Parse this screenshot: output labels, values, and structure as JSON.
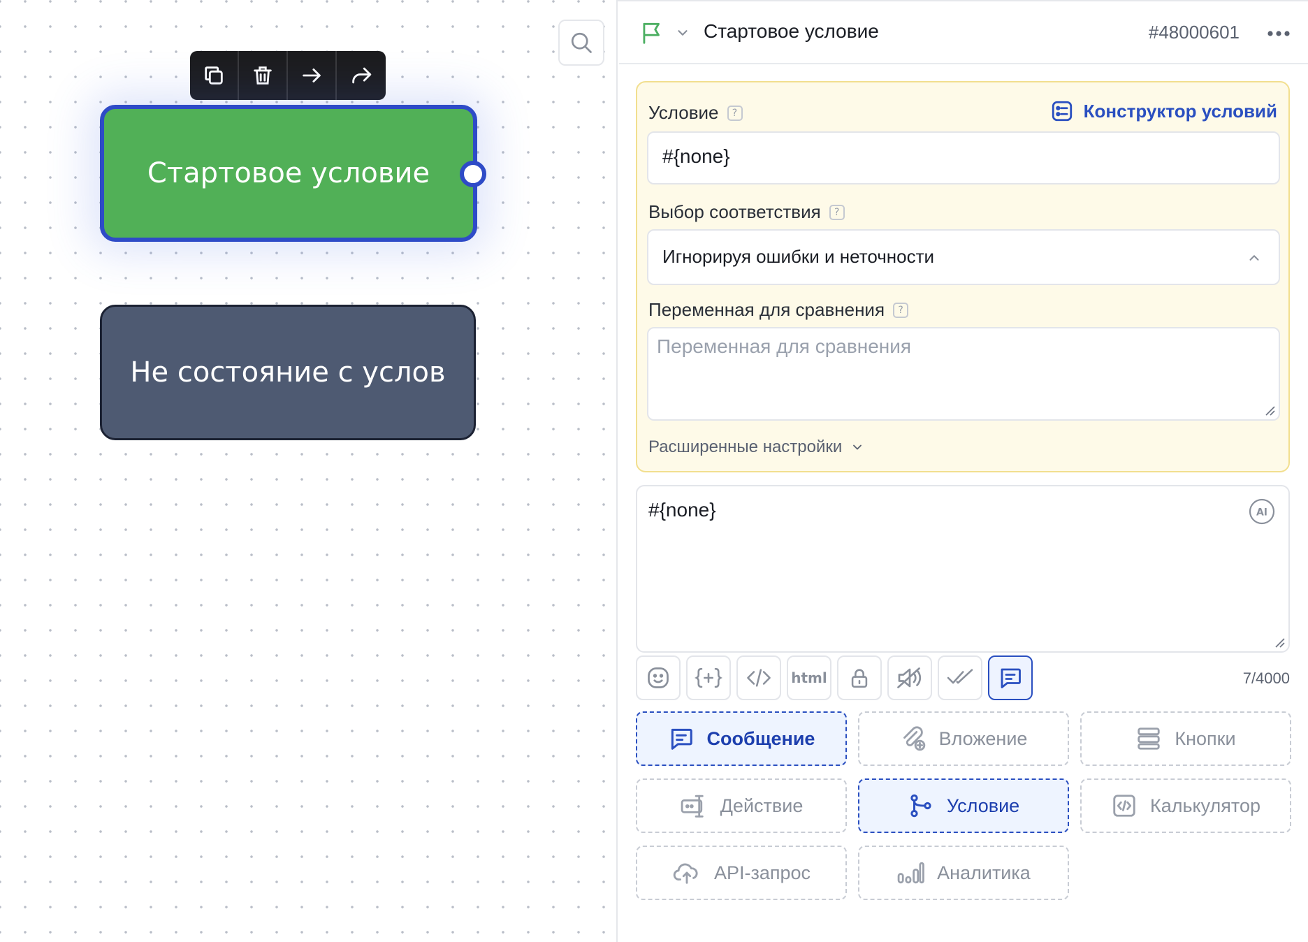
{
  "canvas": {
    "toolbar": {
      "buttons": [
        "copy-icon",
        "trash-icon",
        "arrow-right-icon",
        "share-icon"
      ]
    },
    "nodes": [
      {
        "label": "Стартовое условие",
        "color": "#51b057",
        "selected": true
      },
      {
        "label": "Не состояние с услов",
        "color": "#4e5a72",
        "selected": false
      }
    ]
  },
  "panel": {
    "header": {
      "title": "Стартовое условие",
      "id": "#48000601"
    },
    "condition": {
      "label": "Условие",
      "constructor_link": "Конструктор условий",
      "value": "#{none}"
    },
    "match": {
      "label": "Выбор соответствия",
      "selected": "Игнорируя ошибки и неточности"
    },
    "compare_var": {
      "label": "Переменная для сравнения",
      "placeholder": "Переменная для сравнения",
      "value": ""
    },
    "advanced": {
      "label": "Расширенные настройки"
    },
    "message": {
      "text": "#{none}",
      "char_count": "7/4000"
    },
    "format_buttons": [
      "emoji-icon",
      "variable-icon",
      "code-icon",
      "html",
      "lock-icon",
      "mute-icon",
      "double-check-icon",
      "message-icon"
    ],
    "format_html_label": "html",
    "block_types": [
      {
        "label": "Сообщение",
        "icon": "message-icon",
        "state": "active"
      },
      {
        "label": "Вложение",
        "icon": "attachment-icon",
        "state": "normal"
      },
      {
        "label": "Кнопки",
        "icon": "buttons-icon",
        "state": "normal"
      },
      {
        "label": "Действие",
        "icon": "action-icon",
        "state": "normal"
      },
      {
        "label": "Условие",
        "icon": "branch-icon",
        "state": "active"
      },
      {
        "label": "Калькулятор",
        "icon": "calculator-icon",
        "state": "normal"
      },
      {
        "label": "API-запрос",
        "icon": "cloud-icon",
        "state": "normal"
      },
      {
        "label": "Аналитика",
        "icon": "analytics-icon",
        "state": "normal"
      }
    ],
    "accent_color": "#2a4fc0",
    "condition_box_color": "#fefae8"
  }
}
